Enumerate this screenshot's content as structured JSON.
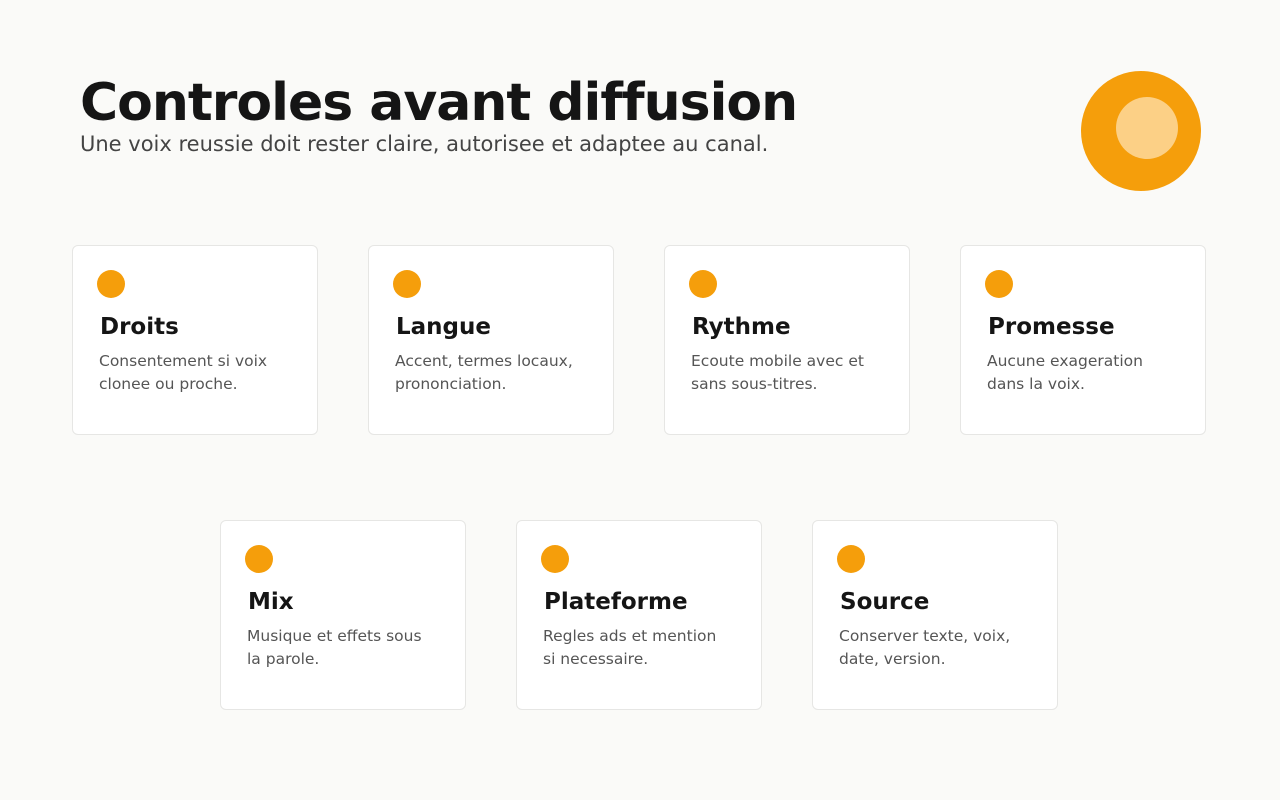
{
  "header": {
    "title": "Controles avant diffusion",
    "subtitle": "Une voix reussie doit rester claire, autorisee et adaptee au canal."
  },
  "colors": {
    "accent": "#f59e0b",
    "accent_light": "#fcd086",
    "background": "#fafaf8",
    "card_background": "#ffffff"
  },
  "cards": [
    {
      "title": "Droits",
      "text": "Consentement si voix clonee ou proche."
    },
    {
      "title": "Langue",
      "text": "Accent, termes locaux, prononciation."
    },
    {
      "title": "Rythme",
      "text": "Ecoute mobile avec et sans sous-titres."
    },
    {
      "title": "Promesse",
      "text": "Aucune exageration dans la voix."
    },
    {
      "title": "Mix",
      "text": "Musique et effets sous la parole."
    },
    {
      "title": "Plateforme",
      "text": "Regles ads et mention si necessaire."
    },
    {
      "title": "Source",
      "text": "Conserver texte, voix, date, version."
    }
  ]
}
